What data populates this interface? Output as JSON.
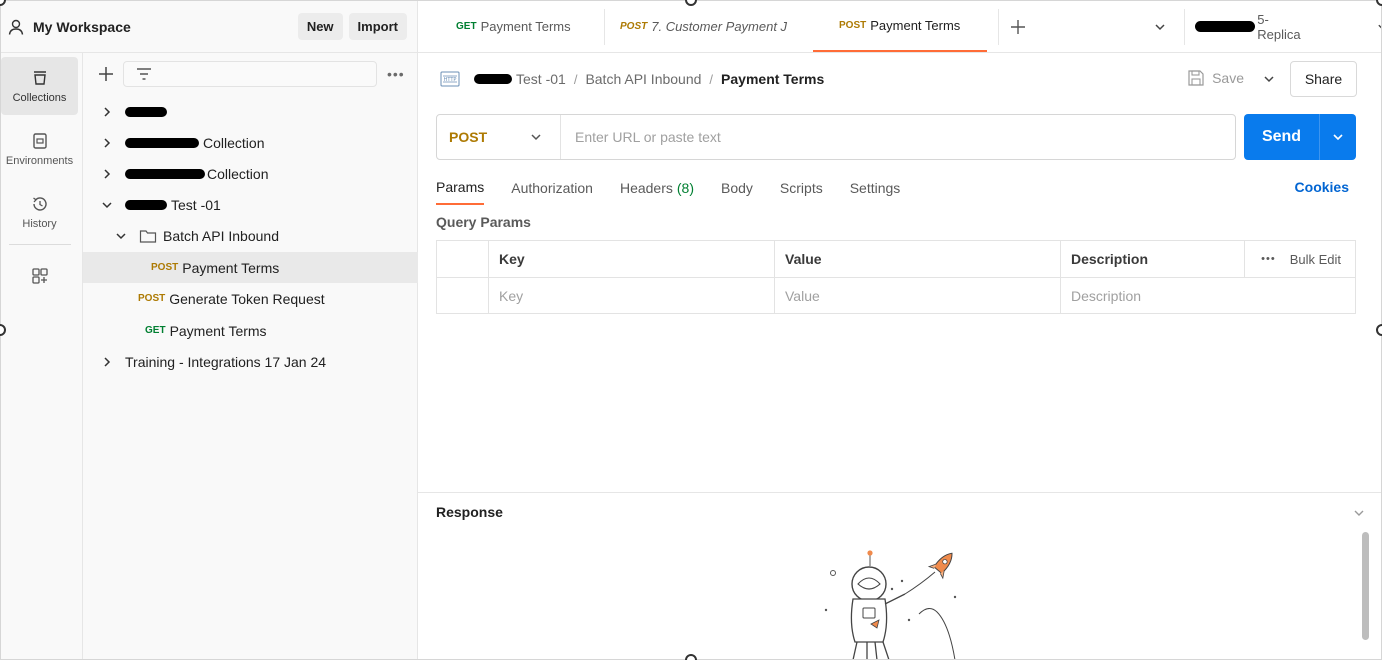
{
  "workspace": {
    "title": "My Workspace",
    "new_label": "New",
    "import_label": "Import"
  },
  "rail": {
    "items": [
      {
        "label": "Collections",
        "icon": "collections-icon",
        "active": true
      },
      {
        "label": "Environments",
        "icon": "environments-icon",
        "active": false
      },
      {
        "label": "History",
        "icon": "history-icon",
        "active": false
      },
      {
        "label": "",
        "icon": "add-widgets-icon",
        "active": false
      }
    ]
  },
  "tree": {
    "filter_placeholder": "",
    "items": [
      {
        "text": "",
        "redacted": true
      },
      {
        "text": "Collection",
        "redacted": true
      },
      {
        "text": "Collection",
        "redacted": true
      },
      {
        "text": "Test -01",
        "redacted": true,
        "expanded": true
      },
      {
        "text": "Batch API Inbound",
        "folder": true,
        "expanded": true
      },
      {
        "method": "POST",
        "text": "Payment Terms",
        "selected": true
      },
      {
        "method": "POST",
        "text": "Generate Token Request"
      },
      {
        "method": "GET",
        "text": "Payment Terms"
      },
      {
        "text": "Training - Integrations 17 Jan 24"
      }
    ]
  },
  "tabs": [
    {
      "method": "GET",
      "name": "Payment Terms",
      "italic": false,
      "active": false
    },
    {
      "method": "POST",
      "name": "7. Customer Payment J",
      "italic": true,
      "active": false
    },
    {
      "method": "POST",
      "name": "Payment Terms",
      "italic": false,
      "active": true
    }
  ],
  "environment": {
    "name": "5-Replica"
  },
  "breadcrumb": {
    "collection": "Test -01",
    "folder": "Batch API Inbound",
    "current": "Payment Terms",
    "separator": "/"
  },
  "actions": {
    "save_label": "Save",
    "share_label": "Share"
  },
  "request": {
    "method": "POST",
    "url_value": "",
    "url_placeholder": "Enter URL or paste text",
    "send_label": "Send"
  },
  "subtabs": [
    {
      "label": "Params",
      "active": true
    },
    {
      "label": "Authorization"
    },
    {
      "label": "Headers",
      "count": "(8)"
    },
    {
      "label": "Body"
    },
    {
      "label": "Scripts"
    },
    {
      "label": "Settings"
    }
  ],
  "cookies_label": "Cookies",
  "query_params": {
    "title": "Query Params",
    "headers": [
      "Key",
      "Value",
      "Description"
    ],
    "placeholders": [
      "Key",
      "Value",
      "Description"
    ],
    "bulk_edit_label": "Bulk Edit",
    "more_label": "•••"
  },
  "response": {
    "title": "Response"
  },
  "colors": {
    "accent": "#ff6c37",
    "post": "#ad7a03",
    "get": "#007f31",
    "send": "#097bed",
    "link": "#0265d2"
  }
}
